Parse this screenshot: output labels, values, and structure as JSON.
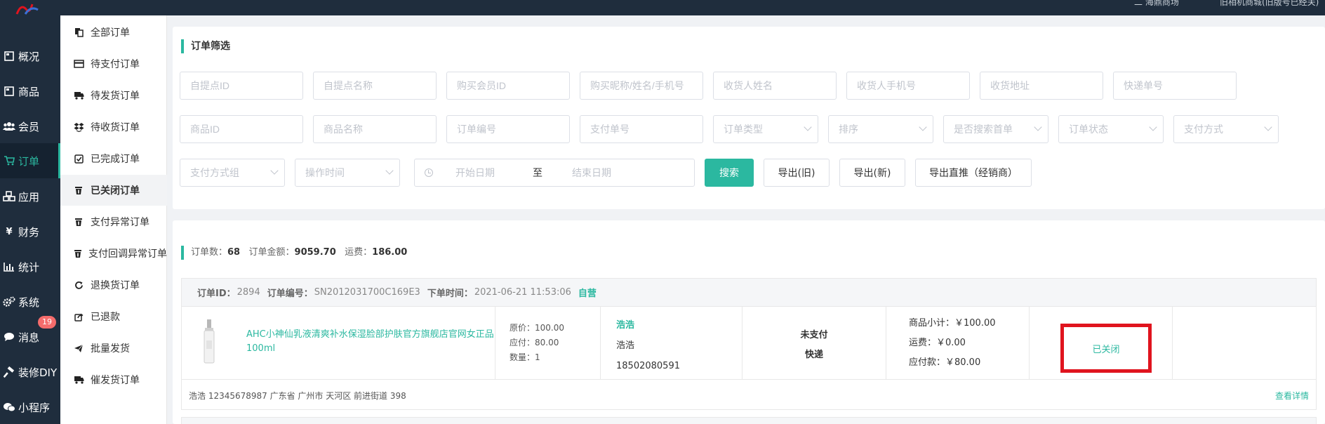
{
  "topbar": {
    "right_text_1": "二 海鼎商场",
    "right_text_2": "旧相机商城(旧版号已经关)"
  },
  "nav": {
    "items": [
      {
        "label": "概况",
        "icon": "dashboard-icon"
      },
      {
        "label": "商品",
        "icon": "goods-icon"
      },
      {
        "label": "会员",
        "icon": "members-icon"
      },
      {
        "label": "订单",
        "icon": "cart-icon"
      },
      {
        "label": "应用",
        "icon": "apps-icon"
      },
      {
        "label": "财务",
        "icon": "yen-icon"
      },
      {
        "label": "统计",
        "icon": "stats-icon"
      },
      {
        "label": "系统",
        "icon": "gear-icon"
      },
      {
        "label": "消息",
        "icon": "message-icon",
        "badge": "19"
      },
      {
        "label": "装修DIY",
        "icon": "hammer-icon"
      },
      {
        "label": "小程序",
        "icon": "wechat-icon"
      }
    ],
    "active": "订单",
    "active_color": "#2bb8a0"
  },
  "submenu": {
    "items": [
      {
        "label": "全部订单",
        "icon": "copy-icon"
      },
      {
        "label": "待支付订单",
        "icon": "credit-card-icon"
      },
      {
        "label": "待发货订单",
        "icon": "truck-icon"
      },
      {
        "label": "待收货订单",
        "icon": "dropbox-icon"
      },
      {
        "label": "已完成订单",
        "icon": "check-square-icon"
      },
      {
        "label": "已关闭订单",
        "icon": "trash-icon"
      },
      {
        "label": "支付异常订单",
        "icon": "trash-icon"
      },
      {
        "label": "支付回调异常订单",
        "icon": "trash-icon"
      },
      {
        "label": "退换货订单",
        "icon": "refresh-icon"
      },
      {
        "label": "已退款",
        "icon": "share-square-icon"
      },
      {
        "label": "批量发货",
        "icon": "paper-plane-icon"
      },
      {
        "label": "催发货订单",
        "icon": "truck-icon"
      }
    ],
    "active": "已关闭订单"
  },
  "filter": {
    "title": "订单筛选",
    "row1": [
      "自提点ID",
      "自提点名称",
      "购买会员ID",
      "购买昵称/姓名/手机号",
      "收货人姓名",
      "收货人手机号",
      "收货地址",
      "快递单号"
    ],
    "row2_inputs": [
      "商品ID",
      "商品名称",
      "订单编号",
      "支付单号"
    ],
    "row2_selects": [
      "订单类型",
      "排序",
      "是否搜索首单",
      "订单状态",
      "支付方式"
    ],
    "row3_selects": [
      "支付方式组",
      "操作时间"
    ],
    "date_start": "开始日期",
    "date_sep": "至",
    "date_end": "结束日期",
    "buttons": {
      "search": "搜索",
      "export_old": "导出(旧)",
      "export_new": "导出(新)",
      "export_direct": "导出直推（经销商）"
    },
    "accent": "#2bb8a0"
  },
  "summary": {
    "count_label": "订单数：",
    "count": "68",
    "amount_label": "订单金额：",
    "amount": "9059.70",
    "freight_label": "运费：",
    "freight": "186.00"
  },
  "order": {
    "id_label": "订单ID：",
    "id": "2894",
    "sn_label": "订单编号：",
    "sn": "SN2012031700C169E3",
    "time_label": "下单时间：",
    "time": "2021-06-21 11:53:06",
    "tag": "自营",
    "product_name": "AHC小神仙乳液清爽补水保湿脸部护肤官方旗舰店官网女正品100ml",
    "original_price": "原价：100.00",
    "payable": "应付：80.00",
    "quantity": "数量：1",
    "buyer_nickname": "浩浩",
    "buyer_name": "浩浩",
    "buyer_phone": "18502080591",
    "pay_status": "未支付",
    "delivery": "快递",
    "subtotal": "商品小计：￥100.00",
    "shipping": "运费：￥0.00",
    "due": "应付款：￥80.00",
    "status": "已关闭",
    "status_highlight_color": "#e0141e",
    "address_line": "浩浩   12345678987   广东省 广州市 天河区 前进街道 398",
    "detail_link": "查看详情"
  }
}
